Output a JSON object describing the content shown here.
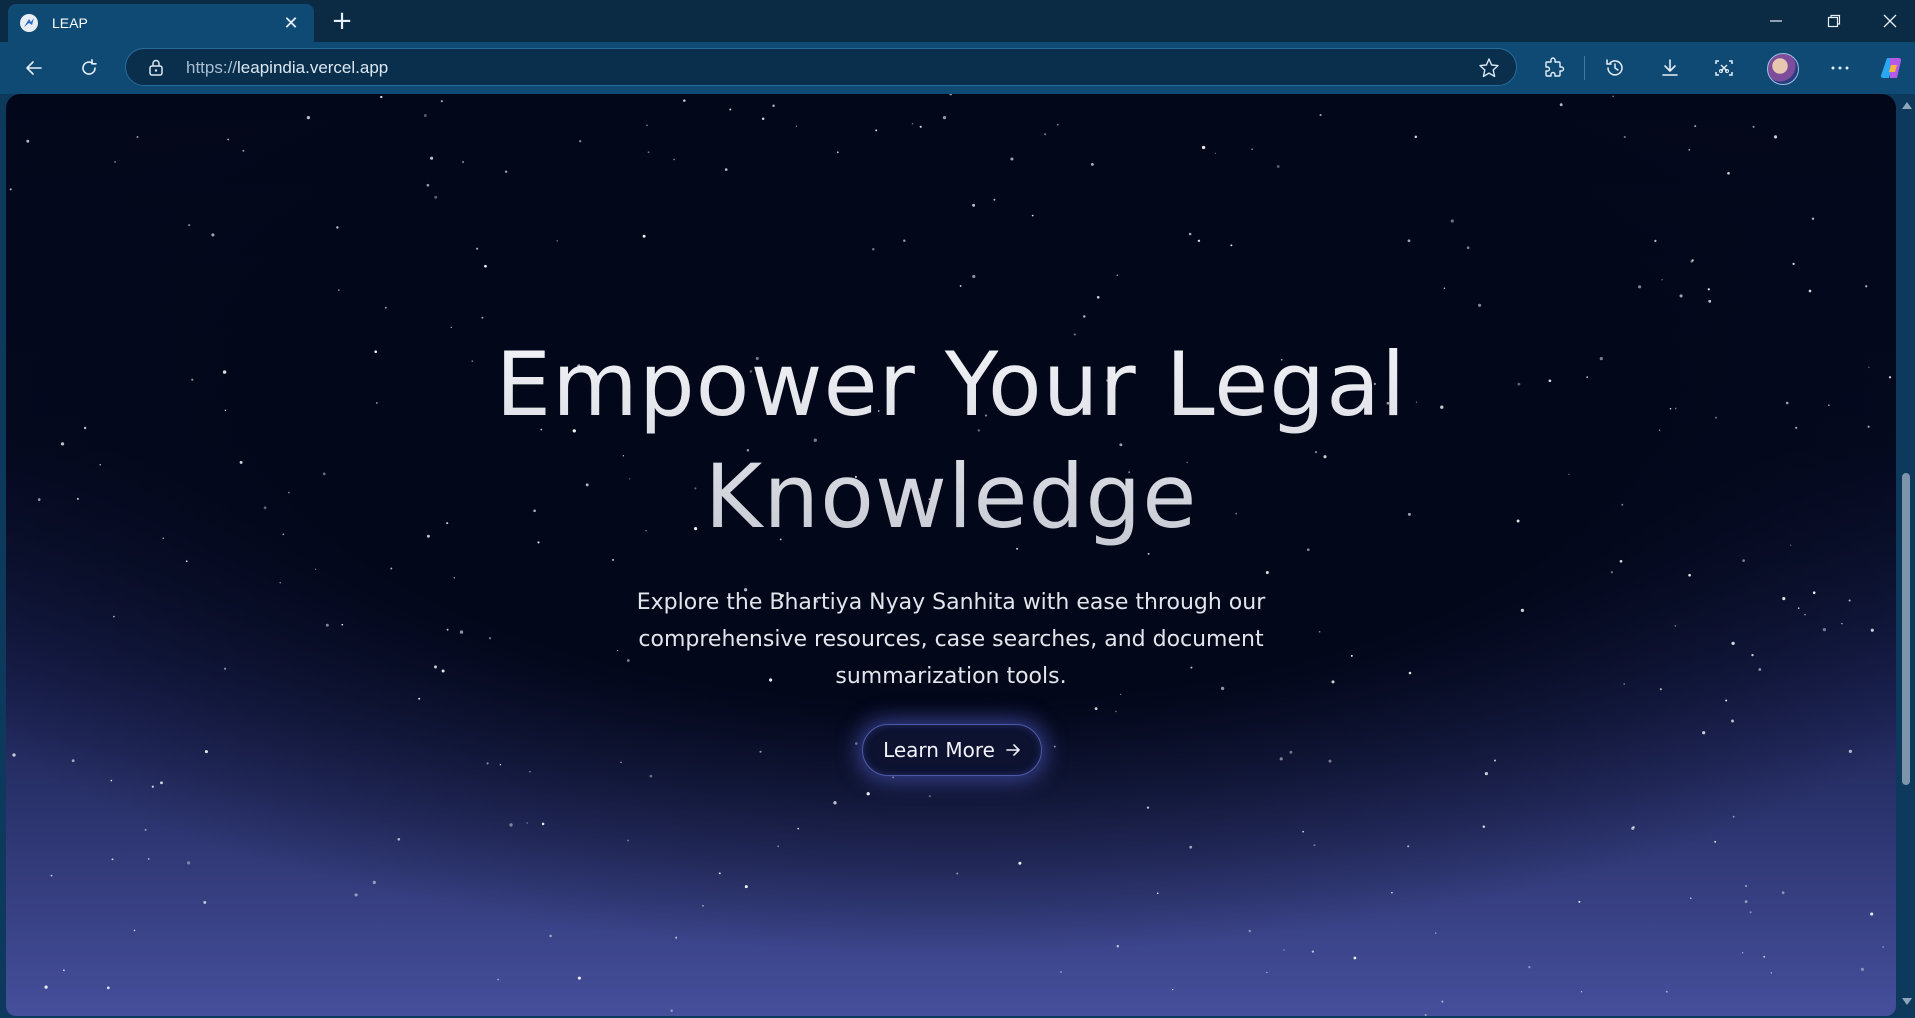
{
  "browser": {
    "tab": {
      "title": "LEAP",
      "favicon": "leap-logo-icon",
      "close_icon": "close-icon"
    },
    "new_tab_icon": "plus-icon",
    "window_controls": [
      "minimize-icon",
      "restore-icon",
      "close-icon"
    ],
    "nav": {
      "back_icon": "arrow-left-icon",
      "reload_icon": "reload-icon"
    },
    "address": {
      "protocol": "https://",
      "host": "leapindia.vercel.app",
      "lock_icon": "lock-icon",
      "favorite_icon": "star-icon"
    },
    "toolbar_icons": [
      "extensions-icon",
      "history-icon",
      "download-icon",
      "screenshot-icon",
      "profile-avatar",
      "more-icon",
      "copilot-icon"
    ]
  },
  "hero": {
    "title_line1": "Empower Your Legal",
    "title_line2": "Knowledge",
    "subtitle_line1": "Explore the Bhartiya Nyay Sanhita with ease through our",
    "subtitle_line2": "comprehensive resources, case searches, and document",
    "subtitle_line3": "summarization tools.",
    "cta_label": "Learn More",
    "cta_icon": "arrow-right-icon"
  },
  "colors": {
    "chrome_frame": "#0b2b45",
    "chrome_toolbar": "#0f4a74",
    "page_top": "#03071a",
    "page_bottom": "#454f9b",
    "cta_glow": "#606ee6"
  }
}
